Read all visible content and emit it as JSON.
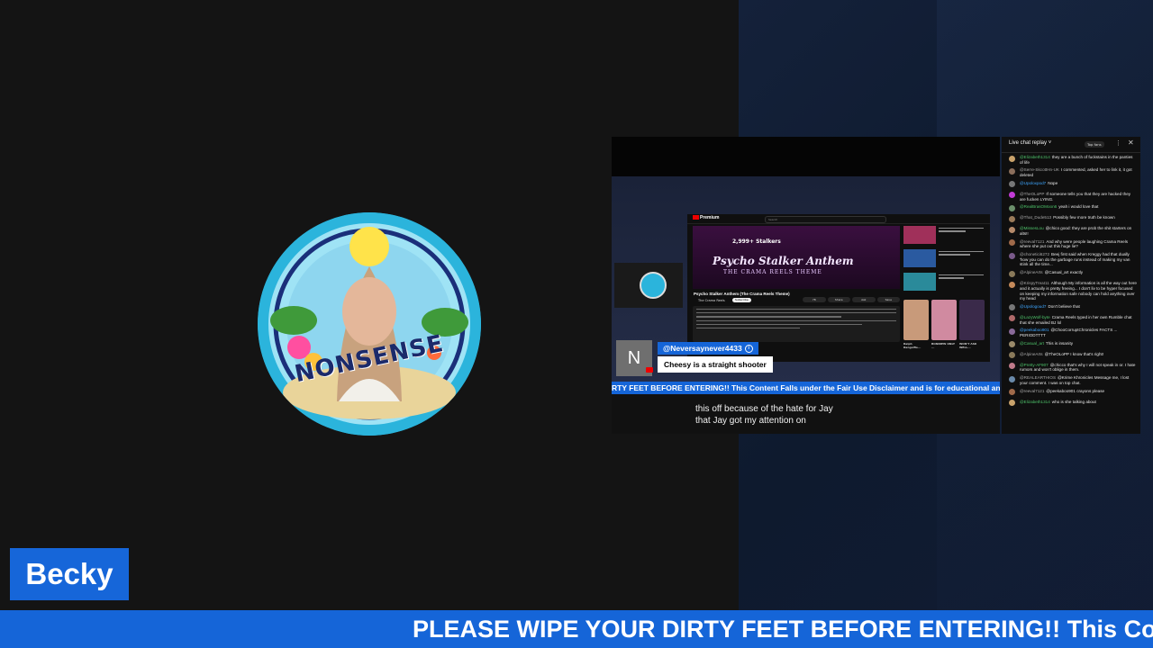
{
  "presenter": {
    "name": "Becky",
    "avatar_text": "NONSENSE"
  },
  "ticker": {
    "text": "PLEASE WIPE YOUR DIRTY FEET BEFORE ENTERING!! This Content"
  },
  "video": {
    "youtube": {
      "logo": "Premium",
      "search_placeholder": "Search",
      "stalkers_badge": "2,999+ Stalkers",
      "player_title": "Psycho Stalker Anthem",
      "player_subtitle": "THE CRAMA REELS THEME",
      "video_title": "Psycho Stalker Anthem (The Crama Reels Theme)",
      "channel": "The Crama Reels",
      "subscribe": "Subscribe",
      "actions": [
        "78",
        "Share",
        "Ask",
        "Save"
      ],
      "shorts": [
        "Ralph Rangelfle...",
        "BONNIEW ONLY ...",
        "WON'T ASK WELL..."
      ]
    },
    "comment": {
      "avatar_letter": "N",
      "handle": "@Neversaynever4433",
      "text": "Cheesy is a straight shooter"
    },
    "ticker_text": "RTY FEET BEFORE ENTERING!! This Content Falls under the Fair Use Disclaimer and is for educational and e",
    "caption_lines": [
      "this off because of the hate for Jay",
      "that Jay got my attention on"
    ]
  },
  "chat": {
    "title": "Live chat replay ˅",
    "top_fans": "Top fans",
    "more_icon": "⋮",
    "close_icon": "✕",
    "messages": [
      {
        "user": "@Elizabeth1314",
        "text": "they are a bunch of fuckstains in the panties of life",
        "color": "#c9a26b",
        "uc": "green"
      },
      {
        "user": "@Serre-SkcottHn-UK",
        "text": "I commented, asked her to link it, it got deleted",
        "color": "#8b6f5c",
        "uc": "gray"
      },
      {
        "user": "@Upoloxpod7",
        "text": "Nope",
        "color": "#777777",
        "uc": "blue"
      },
      {
        "user": "@TheOLoPP",
        "text": "If someone tells you that they are hacked they are fucken LYING.",
        "color": "#c23bd6",
        "uc": "gray"
      },
      {
        "user": "@RealBrasOMoon6",
        "text": "yeah i would love that",
        "color": "#6b8f6b",
        "uc": "green"
      },
      {
        "user": "@That_Dude513",
        "text": "Possibly few more truth be known",
        "color": "#9a7b5a",
        "uc": "gray"
      },
      {
        "user": "@MissesLou",
        "text": "@chico good: they are prob the shit starters on alts!!",
        "color": "#b58a6a",
        "uc": "green"
      },
      {
        "user": "@reeval7121",
        "text": "And why were people laughing Crama Reels where she put out this huge lie?",
        "color": "#a06a4a",
        "uc": "gray"
      },
      {
        "user": "@chonetici6272",
        "text": "Beej first said when Kreggy had that dually 'how you can do the garbage runs instead of making my van stink all the time...",
        "color": "#7a5a8a",
        "uc": "gray"
      },
      {
        "user": "@AlpineArts",
        "text": "@Casual_art exactly",
        "color": "#8a7a5a",
        "uc": "gray"
      },
      {
        "user": "@KrispyTreat11",
        "text": "Although My information is all the way out here and it actually is pretty freeing... I don't liv to be hyper focused on keeping my information safe nobody can hold anything over my head",
        "color": "#c58a5a",
        "uc": "gray"
      },
      {
        "user": "@Upologoud7",
        "text": "Don't believe that",
        "color": "#777777",
        "uc": "blue"
      },
      {
        "user": "@LazyWolf-byte",
        "text": "Crama Reels typed in her own Rumble chat that she emailed BJ lol",
        "color": "#b06a6a",
        "uc": "green"
      },
      {
        "user": "@peekaboo901",
        "text": "@ChooCorruptChronicles FACTS ... PERIODTTTT",
        "color": "#8a6a9a",
        "uc": "blue"
      },
      {
        "user": "@Casual_art",
        "text": "This is insanity",
        "color": "#9a8a6a",
        "uc": "green"
      },
      {
        "user": "@AlpineArts",
        "text": "@TheOLoPP I know that's right!",
        "color": "#8a7a5a",
        "uc": "gray"
      },
      {
        "user": "@Pretty-AF907",
        "text": "@chicco that's why I will not speak in or. I hate rumors and won't oblige in them.",
        "color": "#c07a8a",
        "uc": "green"
      },
      {
        "user": "@REALEARTHIOS",
        "text": "@Krime Khronicles Message me, I lost your comment. I was on top chat.",
        "color": "#6a8aaa",
        "uc": "gray"
      },
      {
        "user": "@reeval7121",
        "text": "@peekaboo901 crayons please",
        "color": "#a06a4a",
        "uc": "gray"
      },
      {
        "user": "@Elizabeth1314",
        "text": "who is she talking about",
        "color": "#c9a26b",
        "uc": "green"
      }
    ]
  }
}
